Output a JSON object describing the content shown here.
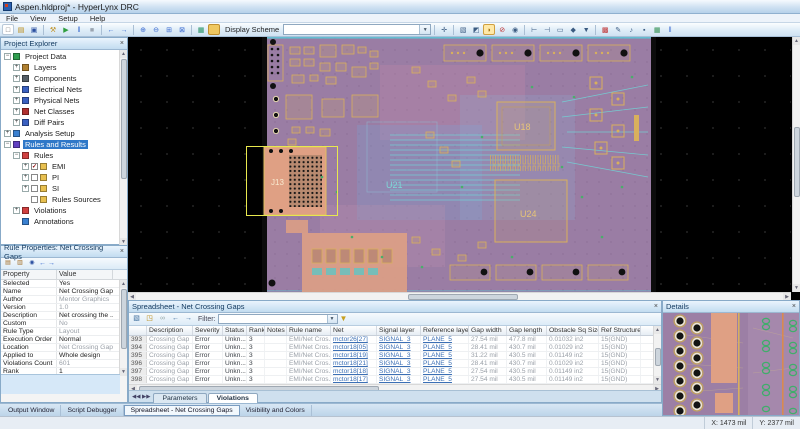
{
  "window": {
    "title": "Aspen.hldproj* - HyperLynx DRC"
  },
  "menu": {
    "items": [
      "File",
      "View",
      "Setup",
      "Help"
    ]
  },
  "toolbar": {
    "display_scheme_label": "Display Scheme",
    "display_scheme_value": "",
    "groups_left": [
      [
        "new-file",
        "open-file",
        "save"
      ],
      [
        "wrench",
        "run",
        "pause",
        "stop"
      ],
      [
        "back",
        "forward"
      ],
      [
        "zoom-in",
        "zoom-out",
        "zoom-area",
        "zoom-fit"
      ],
      [
        "board-view",
        "display-swatch"
      ]
    ],
    "groups_right": [
      [
        "fit-view"
      ],
      [
        "select",
        "highlight",
        "balloon",
        "no-entry",
        "mask"
      ],
      [
        "probe",
        "probe-2",
        "measure",
        "marker",
        "marker-dropdown"
      ],
      [
        "colors",
        "edit",
        "script",
        "options",
        "table",
        "pause-bars"
      ]
    ]
  },
  "icon_glyphs": {
    "new-file": "□",
    "open-file": "▤",
    "save": "▣",
    "wrench": "⚒",
    "run": "▶",
    "pause": "‖",
    "stop": "■",
    "back": "←",
    "forward": "→",
    "zoom-in": "⊕",
    "zoom-out": "⊖",
    "zoom-area": "⊞",
    "zoom-fit": "⊠",
    "board-view": "▦",
    "display-swatch": "",
    "fit-view": "✛",
    "select": "▧",
    "highlight": "◩",
    "balloon": "◗",
    "no-entry": "⊘",
    "mask": "◉",
    "probe": "⊢",
    "probe-2": "⊣",
    "measure": "▭",
    "marker": "◆",
    "marker-dropdown": "▼",
    "colors": "▩",
    "edit": "✎",
    "script": "♪",
    "options": "▪",
    "table": "▦",
    "pause-bars": "‖"
  },
  "project_explorer": {
    "title": "Project Explorer",
    "items": [
      {
        "label": "Project Data",
        "level": 0,
        "expander": "minus",
        "icon": "project-data",
        "selected": false,
        "checkbox": ""
      },
      {
        "label": "Layers",
        "level": 1,
        "expander": "plus",
        "icon": "layers",
        "selected": false,
        "checkbox": ""
      },
      {
        "label": "Components",
        "level": 1,
        "expander": "plus",
        "icon": "components",
        "selected": false,
        "checkbox": ""
      },
      {
        "label": "Electrical Nets",
        "level": 1,
        "expander": "plus",
        "icon": "electrical-nets",
        "selected": false,
        "checkbox": ""
      },
      {
        "label": "Physical Nets",
        "level": 1,
        "expander": "plus",
        "icon": "physical-nets",
        "selected": false,
        "checkbox": ""
      },
      {
        "label": "Net Classes",
        "level": 1,
        "expander": "plus",
        "icon": "net-classes",
        "selected": false,
        "checkbox": ""
      },
      {
        "label": "Diff Pairs",
        "level": 1,
        "expander": "plus",
        "icon": "diff-pairs",
        "selected": false,
        "checkbox": ""
      },
      {
        "label": "Analysis Setup",
        "level": 0,
        "expander": "plus",
        "icon": "analysis-setup",
        "selected": false,
        "checkbox": ""
      },
      {
        "label": "Rules and Results",
        "level": 0,
        "expander": "minus",
        "icon": "rules-results",
        "selected": true,
        "checkbox": ""
      },
      {
        "label": "Rules",
        "level": 1,
        "expander": "minus",
        "icon": "rules-folder",
        "selected": false,
        "checkbox": ""
      },
      {
        "label": "EMI",
        "level": 2,
        "expander": "plus",
        "icon": "folder",
        "selected": false,
        "checkbox": "checked"
      },
      {
        "label": "PI",
        "level": 2,
        "expander": "plus",
        "icon": "folder",
        "selected": false,
        "checkbox": "unchecked"
      },
      {
        "label": "SI",
        "level": 2,
        "expander": "plus",
        "icon": "folder",
        "selected": false,
        "checkbox": "unchecked"
      },
      {
        "label": "Rules Sources",
        "level": 2,
        "expander": "none",
        "icon": "folder",
        "selected": false,
        "checkbox": "unchecked"
      },
      {
        "label": "Violations",
        "level": 1,
        "expander": "plus",
        "icon": "violations",
        "selected": false,
        "checkbox": ""
      },
      {
        "label": "Annotations",
        "level": 1,
        "expander": "none",
        "icon": "annotations",
        "selected": false,
        "checkbox": ""
      }
    ]
  },
  "rule_properties": {
    "title": "Rule Properties: Net Crossing Gaps",
    "columns": {
      "property": "Property",
      "value": "Value"
    },
    "rows": [
      {
        "property": "Selected",
        "value": "Yes",
        "muted": false
      },
      {
        "property": "Name",
        "value": "Net Crossing Gaps",
        "muted": false
      },
      {
        "property": "Author",
        "value": "Mentor Graphics",
        "muted": true
      },
      {
        "property": "Version",
        "value": "1.0",
        "muted": true
      },
      {
        "property": "Description",
        "value": "Net crossing the ...",
        "muted": false
      },
      {
        "property": "Custom",
        "value": "No",
        "muted": true
      },
      {
        "property": "Rule Type",
        "value": "Layout",
        "muted": true
      },
      {
        "property": "Execution Order",
        "value": "Normal",
        "muted": false
      },
      {
        "property": "Location",
        "value": "Net Crossing Gap...",
        "muted": true
      },
      {
        "property": "Applied to",
        "value": "Whole design",
        "muted": false
      },
      {
        "property": "Violations Count",
        "value": "601",
        "muted": true
      },
      {
        "property": "Rank",
        "value": "1",
        "muted": false
      }
    ]
  },
  "board_view": {
    "labels": {
      "j13": "J13",
      "u21": "U21",
      "u18": "U18",
      "u24": "U24"
    }
  },
  "spreadsheet": {
    "title": "Spreadsheet - Net Crossing Gaps",
    "filter_label": "Filter:",
    "columns": [
      "Description",
      "Severity",
      "Status",
      "Rank",
      "Notes",
      "Rule name",
      "Net",
      "Signal layer",
      "Reference layer",
      "Gap width",
      "Gap length",
      "Obstacle Sq Size",
      "Ref Structure"
    ],
    "rows": [
      {
        "num": "393",
        "description": "Crossing Gap",
        "severity": "Error",
        "status": "Unkn...",
        "rank": "3",
        "notes": "",
        "rule_name": "EMI/Net Cros...",
        "net": "mctor26[27]",
        "signal_layer": "SIGNAL_3",
        "reference_layer": "PLANE_5",
        "gap_width": "27.54 mil",
        "gap_length": "477.8 mil",
        "obstacle_sq_size": "0.01032 in2",
        "ref_structure": "15(GND)"
      },
      {
        "num": "394",
        "description": "Crossing Gap",
        "severity": "Error",
        "status": "Unkn...",
        "rank": "3",
        "notes": "",
        "rule_name": "EMI/Net Cros...",
        "net": "mctor18[05]",
        "signal_layer": "SIGNAL_3",
        "reference_layer": "PLANE_5",
        "gap_width": "28.41 mil",
        "gap_length": "430.7 mil",
        "obstacle_sq_size": "0.01029 in2",
        "ref_structure": "15(GND)"
      },
      {
        "num": "395",
        "description": "Crossing Gap",
        "severity": "Error",
        "status": "Unkn...",
        "rank": "3",
        "notes": "",
        "rule_name": "EMI/Net Cros...",
        "net": "mctor18[19]",
        "signal_layer": "SIGNAL_3",
        "reference_layer": "PLANE_5",
        "gap_width": "31.22 mil",
        "gap_length": "430.5 mil",
        "obstacle_sq_size": "0.01149 in2",
        "ref_structure": "15(GND)"
      },
      {
        "num": "396",
        "description": "Crossing Gap",
        "severity": "Error",
        "status": "Unkn...",
        "rank": "3",
        "notes": "",
        "rule_name": "EMI/Net Cros...",
        "net": "mctor18[21]",
        "signal_layer": "SIGNAL_3",
        "reference_layer": "PLANE_5",
        "gap_width": "28.41 mil",
        "gap_length": "430.7 mil",
        "obstacle_sq_size": "0.01029 in2",
        "ref_structure": "15(GND)"
      },
      {
        "num": "397",
        "description": "Crossing Gap",
        "severity": "Error",
        "status": "Unkn...",
        "rank": "3",
        "notes": "",
        "rule_name": "EMI/Net Cros...",
        "net": "mctor18[18]",
        "signal_layer": "SIGNAL_3",
        "reference_layer": "PLANE_5",
        "gap_width": "27.54 mil",
        "gap_length": "430.5 mil",
        "obstacle_sq_size": "0.01149 in2",
        "ref_structure": "15(GND)"
      },
      {
        "num": "398",
        "description": "Crossing Gap",
        "severity": "Error",
        "status": "Unkn...",
        "rank": "3",
        "notes": "",
        "rule_name": "EMI/Net Cros...",
        "net": "mctor18[17]",
        "signal_layer": "SIGNAL_3",
        "reference_layer": "PLANE_5",
        "gap_width": "27.54 mil",
        "gap_length": "430.5 mil",
        "obstacle_sq_size": "0.01149 in2",
        "ref_structure": "15(GND)"
      }
    ],
    "tabs": [
      {
        "label": "Parameters",
        "active": false
      },
      {
        "label": "Violations",
        "active": true
      }
    ]
  },
  "details": {
    "title": "Details"
  },
  "bottom_tabs": [
    {
      "label": "Output Window",
      "active": false
    },
    {
      "label": "Script Debugger",
      "active": false
    },
    {
      "label": "Spreadsheet - Net Crossing Gaps",
      "active": true
    },
    {
      "label": "Visibility and Colors",
      "active": false
    }
  ],
  "status_bar": {
    "x": "X: 1473 mil",
    "y": "Y: 2377 mil"
  },
  "colors": {
    "board_purple": "#9a7da4",
    "gold": "#d9b05c",
    "salmon": "#dfa084",
    "teal": "#5fd2d2",
    "green": "#4aae6a",
    "selection_yellow": "#e8e84e",
    "link_blue": "#3b6fb5",
    "tree_selection": "#2f78c8"
  }
}
